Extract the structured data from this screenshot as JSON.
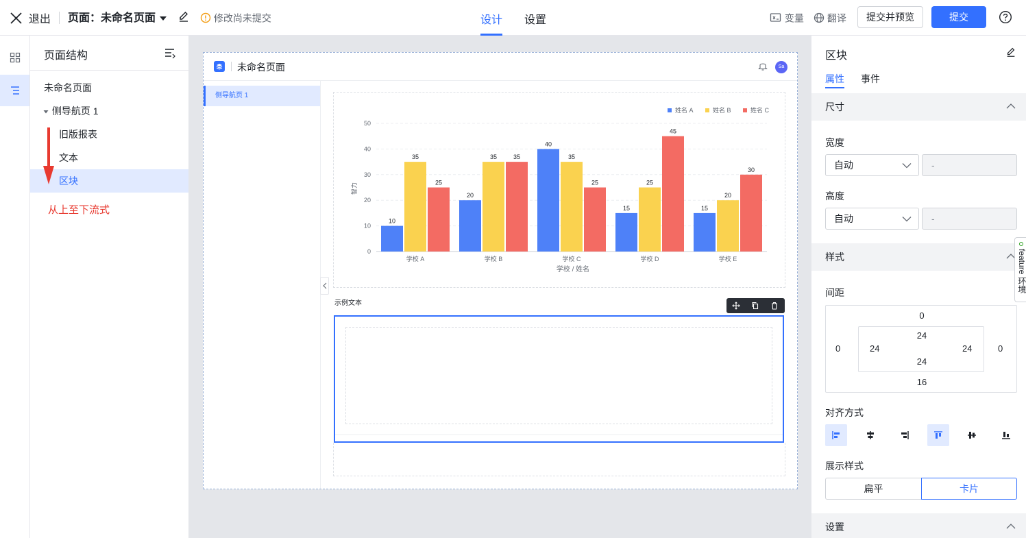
{
  "topbar": {
    "exit_label": "退出",
    "page_label": "页面：未命名页面",
    "unsaved_label": "修改尚未提交",
    "tabs": [
      {
        "label": "设计"
      },
      {
        "label": "设置"
      }
    ],
    "variables_label": "变量",
    "translate_label": "翻译",
    "submit_preview_label": "提交并预览",
    "submit_label": "提交"
  },
  "structure": {
    "title": "页面结构",
    "items": [
      {
        "label": "未命名页面"
      },
      {
        "label": "侧导航页 1"
      },
      {
        "label": "旧版报表"
      },
      {
        "label": "文本"
      },
      {
        "label": "区块"
      }
    ],
    "annotation": "从上至下流式"
  },
  "preview": {
    "app_title": "未命名页面",
    "avatar_text": "Sa",
    "nav_item": "侧导航页 1",
    "sample_text": "示例文本"
  },
  "chart_data": {
    "type": "bar",
    "categories": [
      "学校 A",
      "学校 B",
      "学校 C",
      "学校 D",
      "学校 E"
    ],
    "series": [
      {
        "name": "姓名 A",
        "values": [
          10,
          20,
          40,
          15,
          15
        ],
        "color": "#4e81f8"
      },
      {
        "name": "姓名 B",
        "values": [
          35,
          35,
          35,
          25,
          20
        ],
        "color": "#fad24f"
      },
      {
        "name": "姓名 C",
        "values": [
          25,
          35,
          25,
          45,
          30
        ],
        "color": "#f36b63"
      }
    ],
    "xlabel": "学校 / 姓名",
    "ylabel": "智力",
    "ylim": [
      0,
      50
    ],
    "yticks": [
      "0",
      "10",
      "20",
      "30",
      "40",
      "50"
    ],
    "grid": true,
    "legend": "top-right"
  },
  "props": {
    "title": "区块",
    "tabs": [
      {
        "label": "属性"
      },
      {
        "label": "事件"
      }
    ],
    "size_section": "尺寸",
    "width_label": "宽度",
    "width_value": "自动",
    "width_input": "-",
    "height_label": "高度",
    "height_value": "自动",
    "height_input": "-",
    "style_section": "样式",
    "spacing_label": "间距",
    "margin": {
      "top": "0",
      "right": "0",
      "bottom": "16",
      "left": "0"
    },
    "padding": {
      "top": "24",
      "right": "24",
      "bottom": "24",
      "left": "24"
    },
    "align_label": "对齐方式",
    "display_label": "展示样式",
    "display_options": [
      {
        "label": "扁平"
      },
      {
        "label": "卡片"
      }
    ],
    "settings_section": "设置",
    "feature_tab": "feature 环境"
  },
  "colors": {
    "accent": "#3370ff",
    "annotation": "#e83a30"
  }
}
